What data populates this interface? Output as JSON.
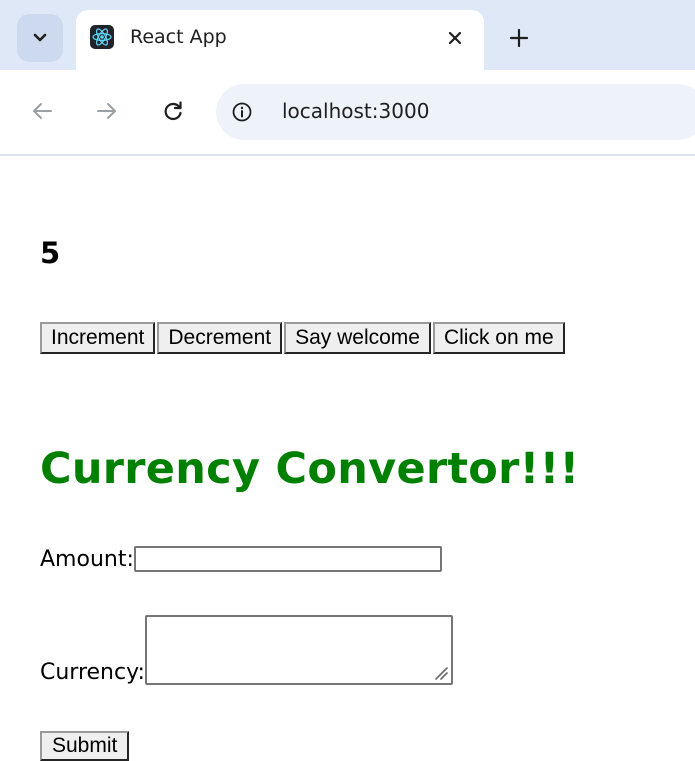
{
  "browser": {
    "tab": {
      "favicon": "react-logo-icon",
      "title": "React App"
    },
    "new_tab_symbol": "+",
    "address_bar": {
      "url": "localhost:3000"
    },
    "colors": {
      "tabbar_bg": "#dfe8f7",
      "omnibox_bg": "#eef2f9"
    }
  },
  "app": {
    "counter_value": "5",
    "buttons": {
      "increment": "Increment",
      "decrement": "Decrement",
      "say_welcome": "Say welcome",
      "click_on_me": "Click on me"
    },
    "converter": {
      "heading": "Currency Convertor!!!",
      "heading_color": "#008000",
      "amount_label": "Amount:",
      "amount_value": "",
      "currency_label": "Currency:",
      "currency_value": "",
      "submit_label": "Submit"
    }
  }
}
